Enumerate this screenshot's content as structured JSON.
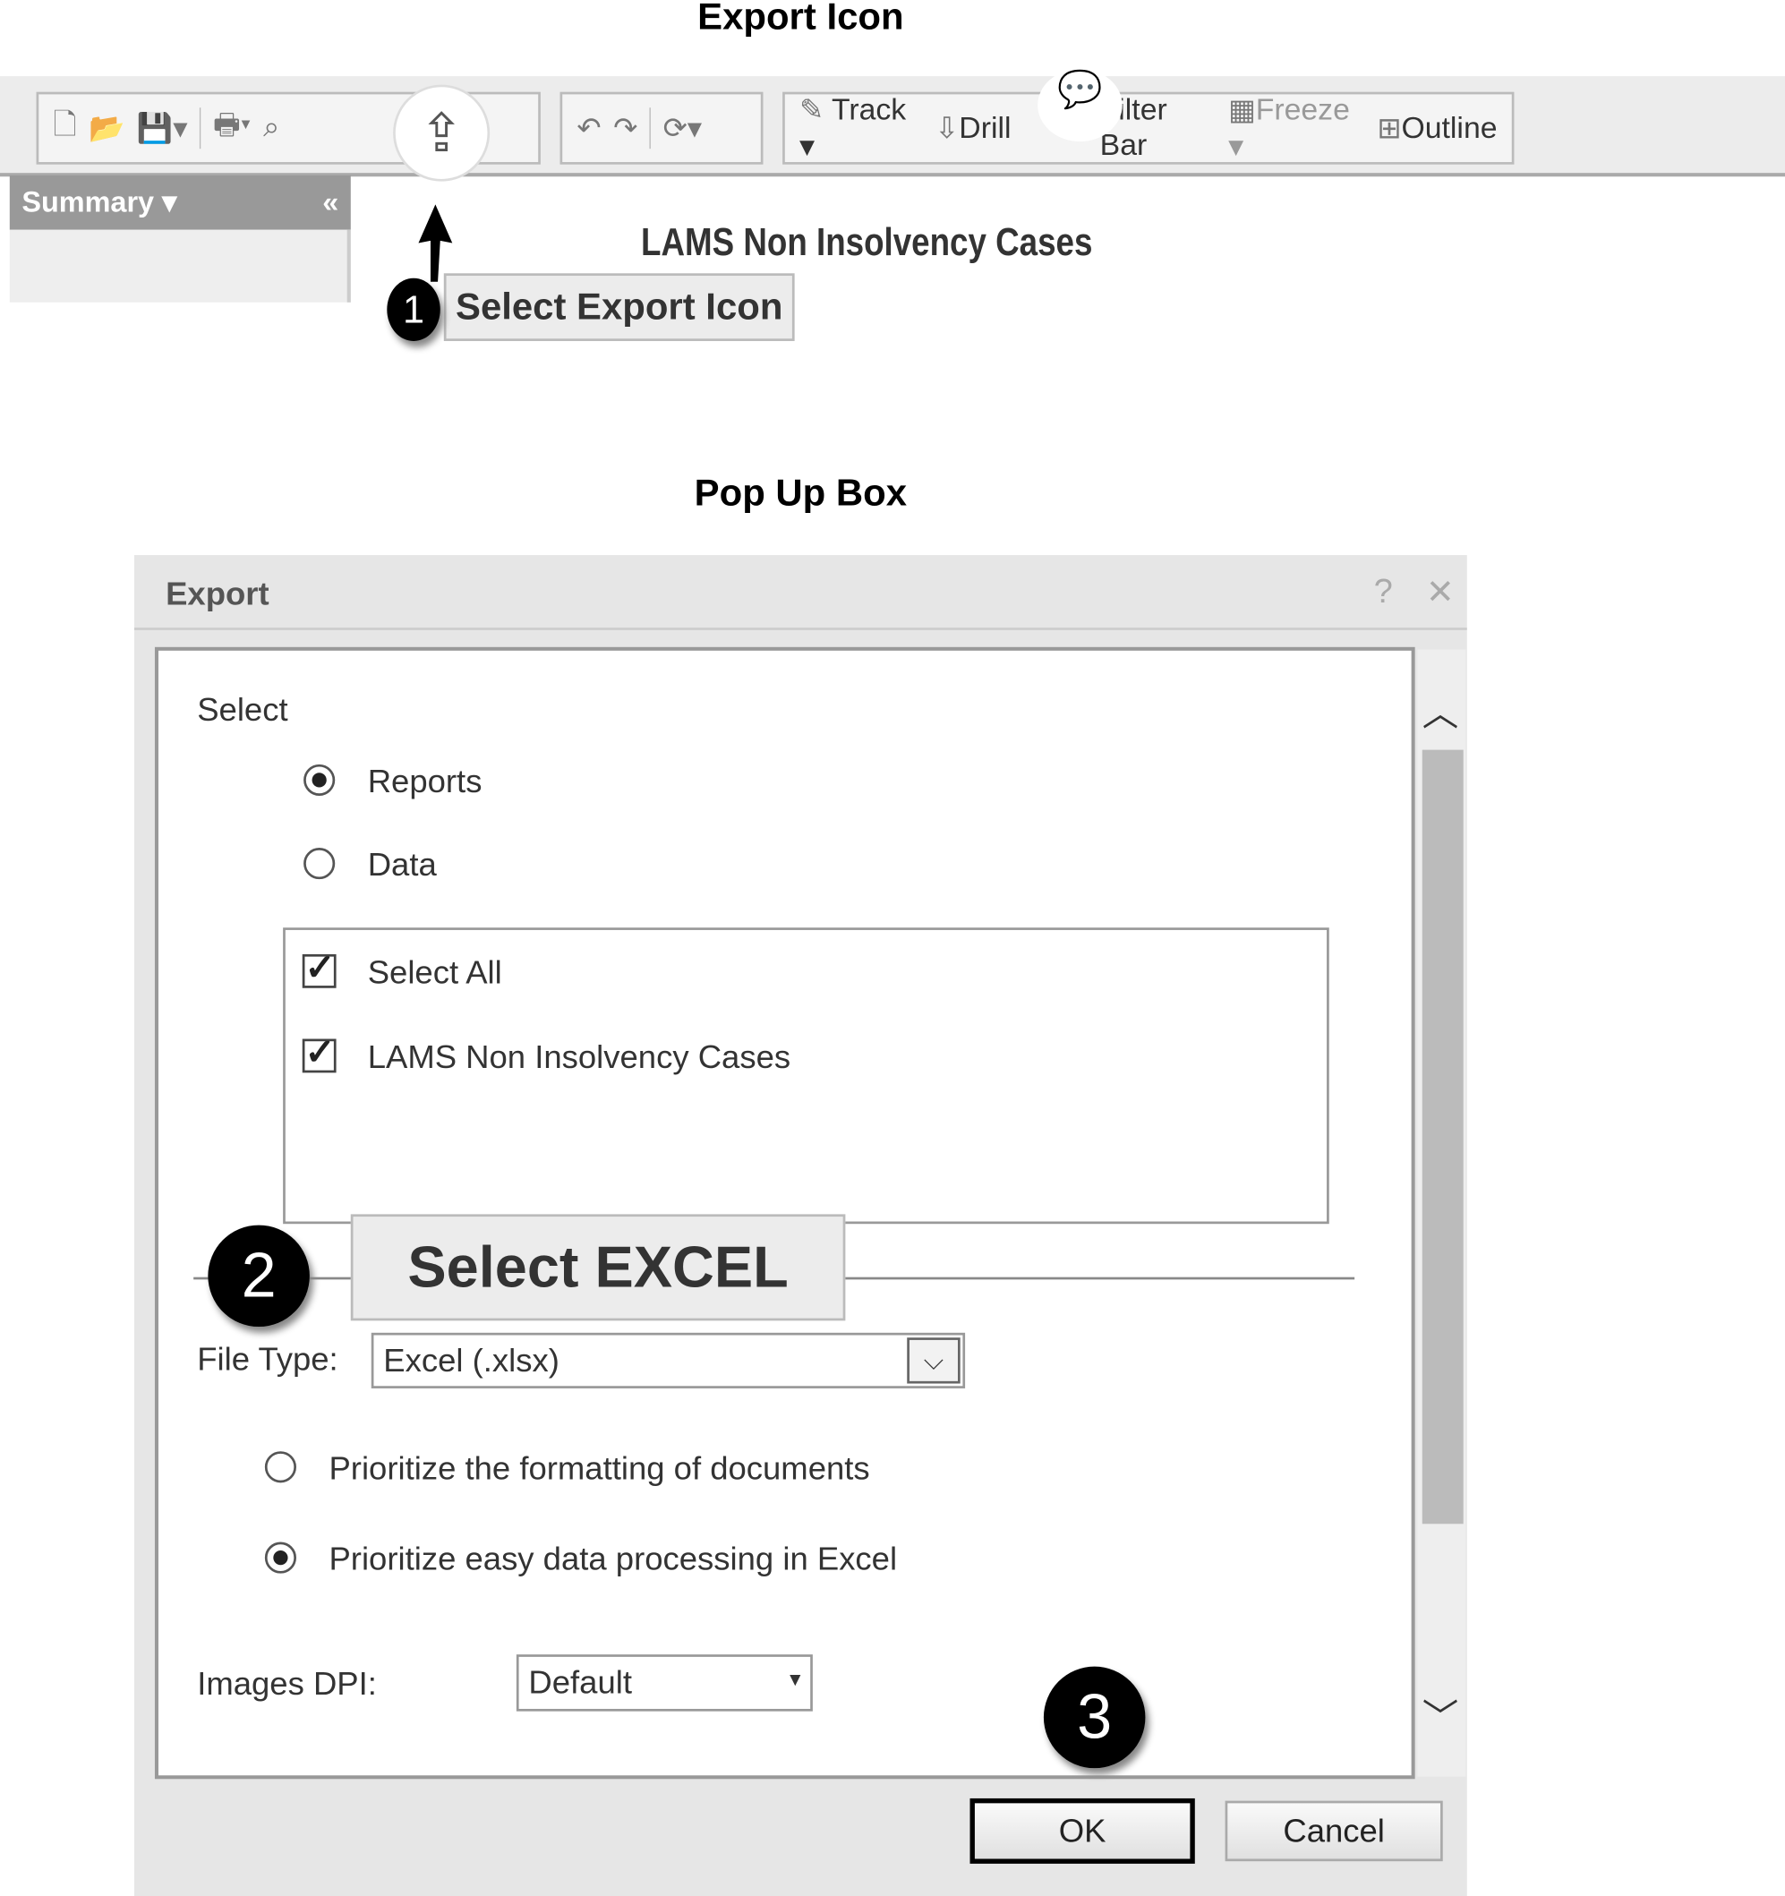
{
  "headings": {
    "export_icon": "Export Icon",
    "popup_box": "Pop Up Box"
  },
  "toolbar": {
    "track": "Track",
    "drill": "Drill",
    "filter_bar": "Filter Bar",
    "freeze": "Freeze",
    "outline": "Outline"
  },
  "sidebar": {
    "summary": "Summary",
    "collapse": "«"
  },
  "report": {
    "title": "LAMS Non Insolvency Cases"
  },
  "callouts": [
    {
      "number": "1",
      "text": "Select Export Icon"
    },
    {
      "number": "2",
      "text": "Select EXCEL"
    },
    {
      "number": "3"
    }
  ],
  "dialog": {
    "title": "Export",
    "select_label": "Select",
    "radio_reports": "Reports",
    "radio_data": "Data",
    "selected_mode": "Reports",
    "list": [
      {
        "label": "Select All",
        "checked": true
      },
      {
        "label": "LAMS Non Insolvency Cases",
        "checked": true
      }
    ],
    "file_type_label": "File Type:",
    "file_type_value": "Excel (.xlsx)",
    "option_formatting": "Prioritize the formatting of documents",
    "option_data": "Prioritize easy data processing in Excel",
    "selected_option": "Prioritize easy data processing in Excel",
    "dpi_label": "Images DPI:",
    "dpi_value": "Default",
    "ok": "OK",
    "cancel": "Cancel"
  }
}
